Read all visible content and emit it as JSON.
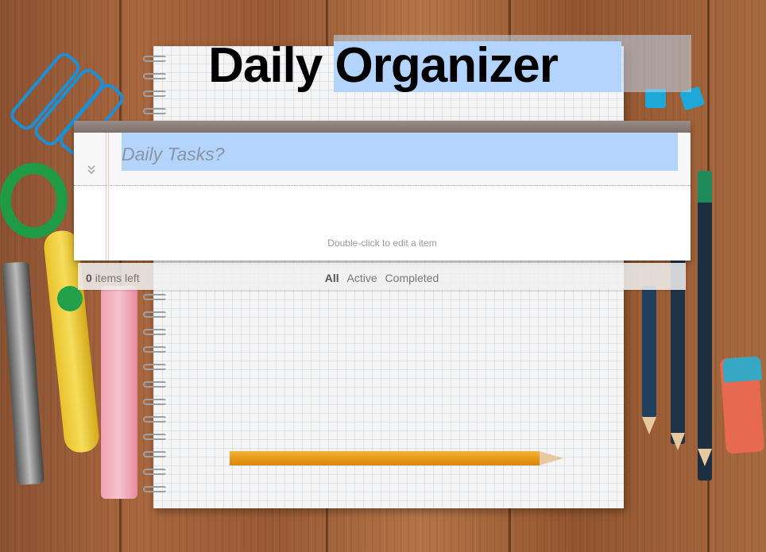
{
  "app": {
    "title_word1": "Daily",
    "title_word2": "Organizer"
  },
  "todo": {
    "new_placeholder": "Daily Tasks?",
    "new_value": "",
    "toggle_all_icon": "double-chevron-down-icon",
    "hint": "Double-click to edit a item"
  },
  "footer": {
    "count": "0",
    "count_suffix": "items left",
    "filters": [
      "All",
      "Active",
      "Completed"
    ],
    "selected_filter": "All"
  },
  "colors": {
    "selection_highlight": "#b3d4fc",
    "card_top_bar": "#8c7e78"
  }
}
